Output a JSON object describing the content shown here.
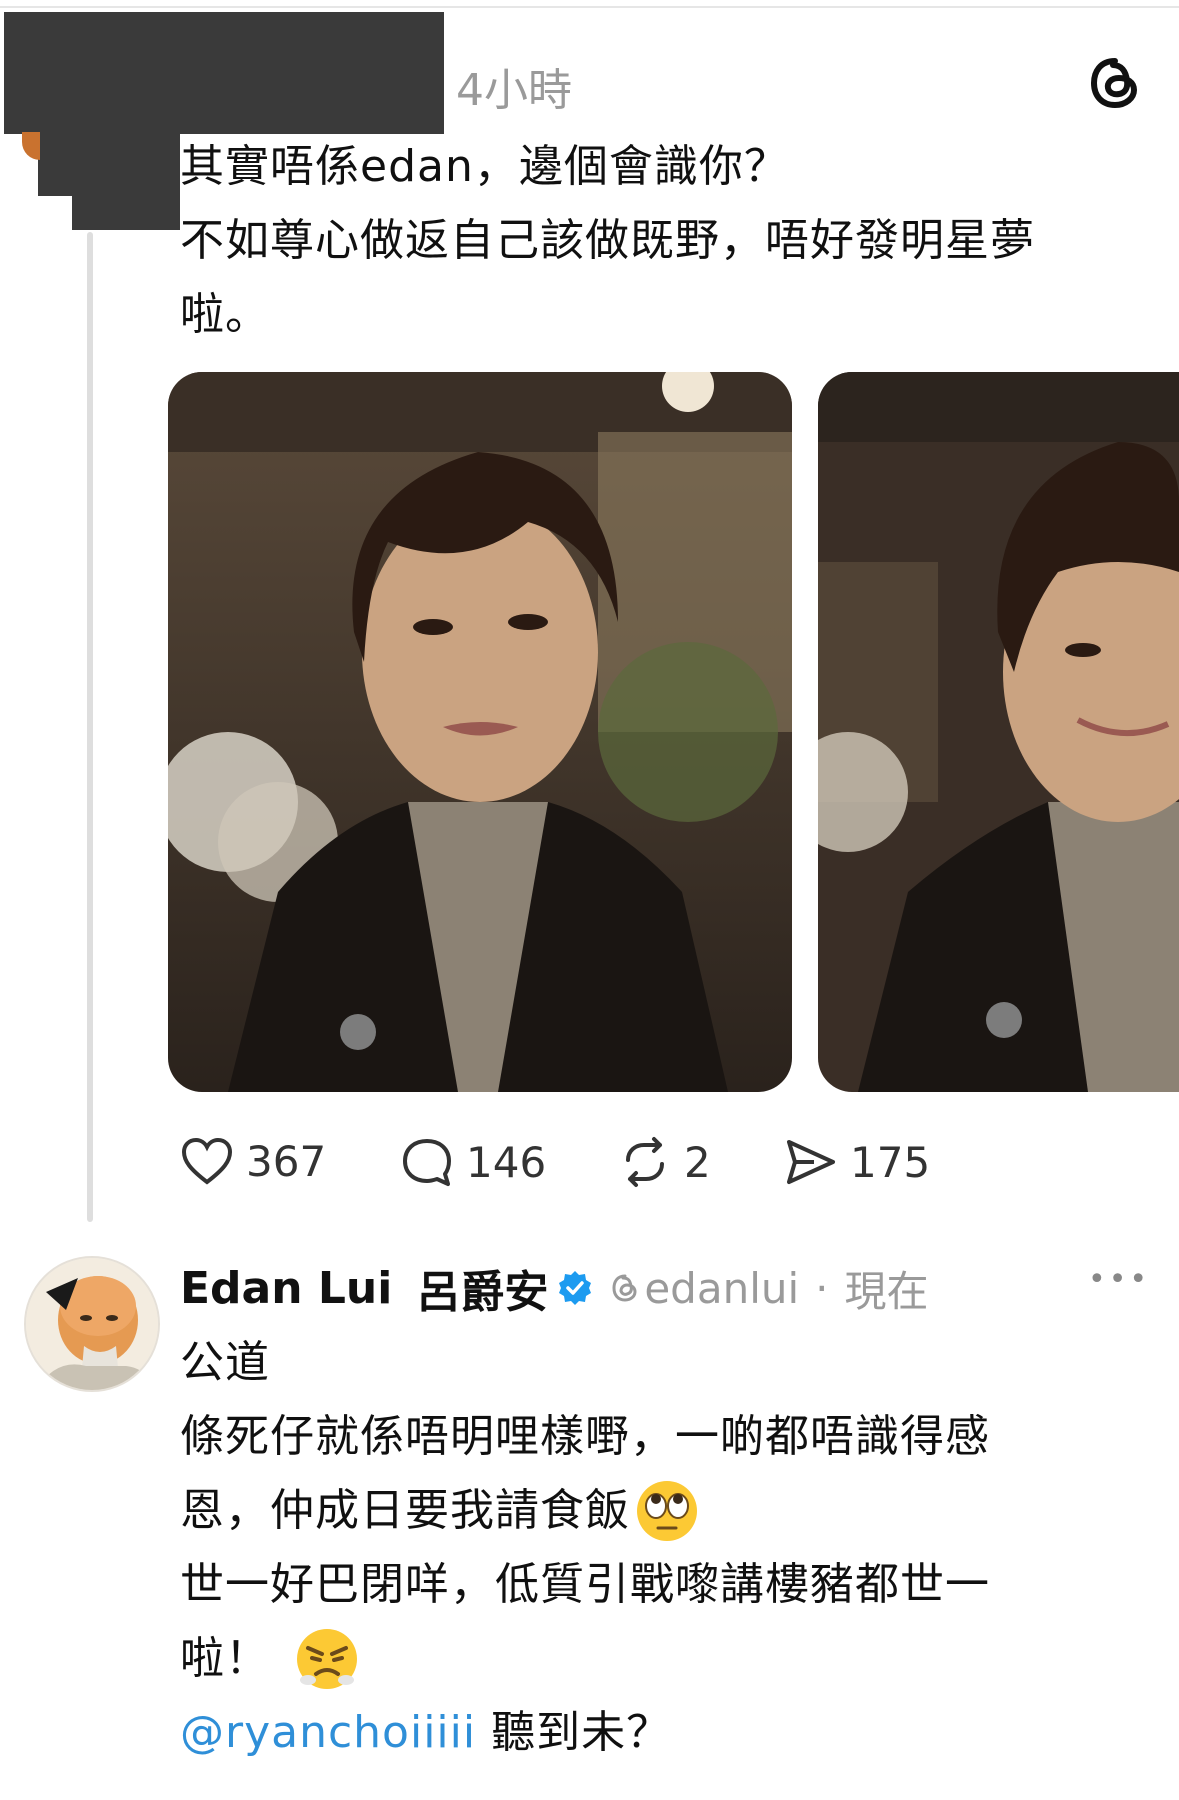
{
  "first_post": {
    "timestamp": "4小時",
    "text_lines": [
      "其實唔係edan，邊個會識你？",
      "不如尊心做返自己該做既野，唔好發明星夢",
      "啦。"
    ],
    "actions": {
      "likes": "367",
      "replies": "146",
      "reposts": "2",
      "shares": "175"
    }
  },
  "reply": {
    "display_name": "Edan Lui",
    "display_name_cn": "呂爵安",
    "handle": "edanlui",
    "separator": "·",
    "time": "現在",
    "more": "•••",
    "lines": [
      "公道",
      "條死仔就係唔明哩樣嘢，一啲都唔識得感",
      "恩，仲成日要我請食飯",
      "世一好巴閉咩，低質引戰嚟講樓豬都世一",
      "啦！"
    ],
    "mention": "@ryanchoiiiii",
    "mention_suffix": " 聽到未？"
  },
  "icons": {
    "app": "threads-logo-icon",
    "like": "heart-icon",
    "reply": "comment-icon",
    "repost": "repost-icon",
    "share": "send-icon",
    "verified": "verified-badge-icon",
    "more": "more-icon"
  },
  "colors": {
    "link": "#2f8fd8",
    "verified": "#1d9bf0",
    "meta": "#9a9a9a"
  }
}
